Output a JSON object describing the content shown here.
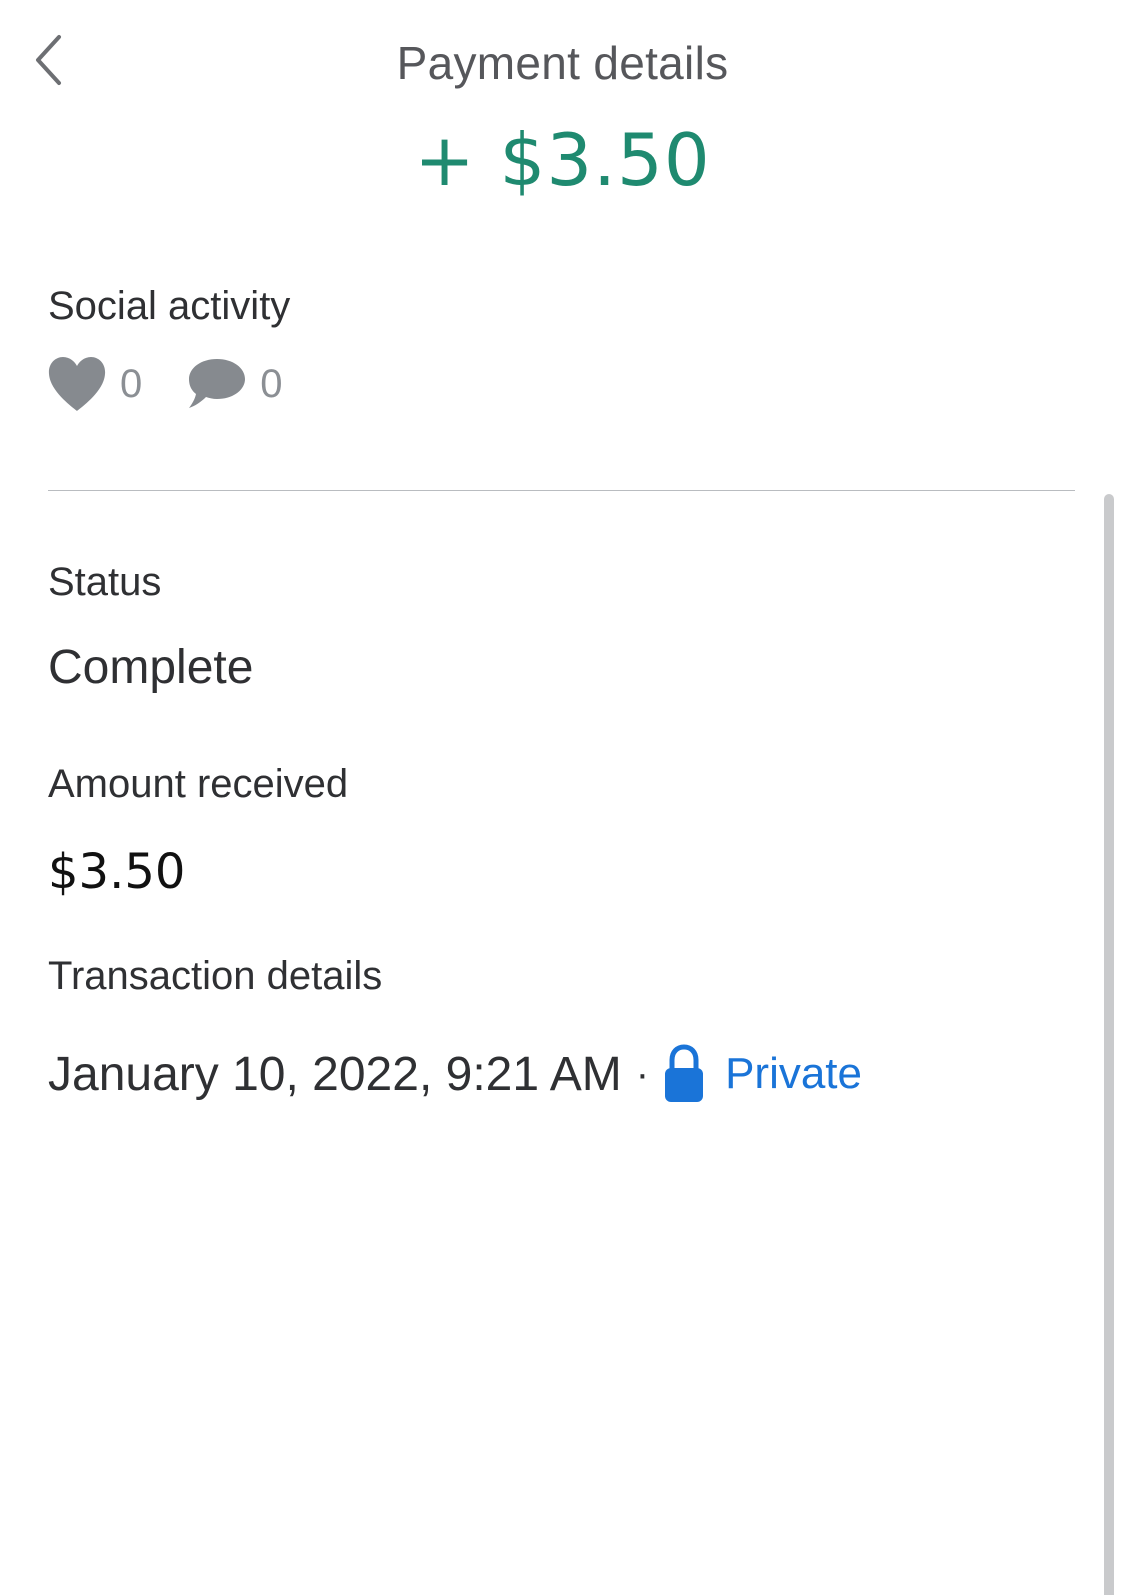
{
  "header": {
    "back_icon": "chevron-left-icon",
    "title": "Payment details",
    "amount": "+ $3.50",
    "amount_color": "#1f8a70"
  },
  "social": {
    "label": "Social activity",
    "likes_icon": "heart-icon",
    "likes_count": "0",
    "comments_icon": "comment-bubble-icon",
    "comments_count": "0"
  },
  "status": {
    "label": "Status",
    "value": "Complete"
  },
  "amount_received": {
    "label": "Amount received",
    "value": "$3.50"
  },
  "transaction": {
    "label": "Transaction details",
    "datetime": "January 10, 2022, 9:21 AM",
    "separator": "·",
    "privacy_icon": "lock-icon",
    "privacy_label": "Private",
    "privacy_color": "#1a74d8"
  }
}
